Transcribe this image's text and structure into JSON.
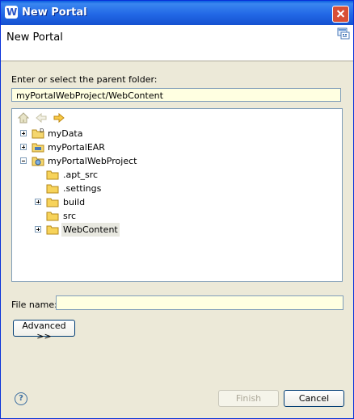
{
  "window": {
    "title": "New Portal",
    "icon": "websphere-app-icon",
    "close_icon": "close-icon"
  },
  "header": {
    "title": "New Portal",
    "banner_icon": "portal-wizard-icon"
  },
  "parent_folder": {
    "label": "Enter or select the parent folder:",
    "value": "myPortalWebProject/WebContent"
  },
  "tree_toolbar": {
    "home_icon": "home-icon",
    "back_icon": "back-arrow-icon",
    "forward_icon": "forward-arrow-icon"
  },
  "tree": {
    "items": [
      {
        "label": "myData",
        "icon": "project-icon",
        "expander": "collapsed",
        "level": 0
      },
      {
        "label": "myPortalEAR",
        "icon": "ear-project-icon",
        "expander": "collapsed",
        "level": 0
      },
      {
        "label": "myPortalWebProject",
        "icon": "web-project-icon",
        "expander": "expanded",
        "level": 0
      },
      {
        "label": ".apt_src",
        "icon": "folder-icon",
        "expander": "none",
        "level": 1
      },
      {
        "label": ".settings",
        "icon": "folder-icon",
        "expander": "none",
        "level": 1
      },
      {
        "label": "build",
        "icon": "folder-icon",
        "expander": "collapsed",
        "level": 1
      },
      {
        "label": "src",
        "icon": "folder-icon",
        "expander": "none",
        "level": 1
      },
      {
        "label": "WebContent",
        "icon": "folder-icon",
        "expander": "collapsed",
        "level": 1,
        "selected": true
      }
    ]
  },
  "file_name": {
    "label": "File name:",
    "value": ""
  },
  "buttons": {
    "advanced": "Advanced >>",
    "finish": "Finish",
    "cancel": "Cancel",
    "help_icon": "help-icon"
  },
  "colors": {
    "title_bar": "#2268e6",
    "input_background": "#ffffe1",
    "dialog_background": "#ece9d8",
    "selection": "#e8e8e0"
  }
}
